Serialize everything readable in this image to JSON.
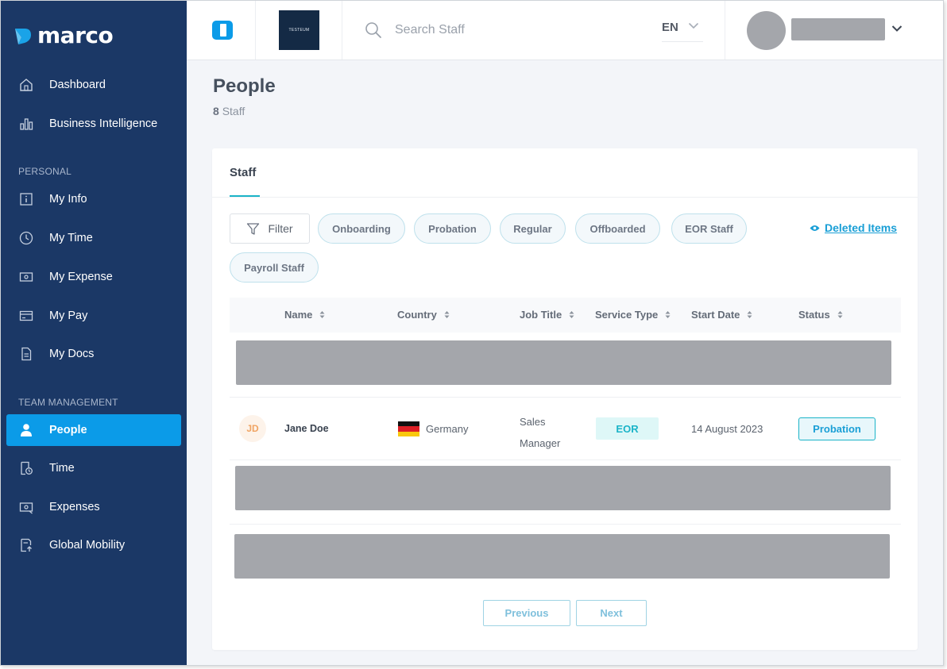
{
  "sidebar": {
    "logo_text": "marco",
    "items_top": [
      {
        "label": "Dashboard",
        "icon": "home-icon"
      },
      {
        "label": "Business Intelligence",
        "icon": "bar-chart-icon"
      }
    ],
    "section_personal": "PERSONAL",
    "items_personal": [
      {
        "label": "My Info",
        "icon": "info-icon"
      },
      {
        "label": "My Time",
        "icon": "clock-icon"
      },
      {
        "label": "My Expense",
        "icon": "expense-icon"
      },
      {
        "label": "My Pay",
        "icon": "card-icon"
      },
      {
        "label": "My Docs",
        "icon": "document-icon"
      }
    ],
    "section_team": "TEAM MANAGEMENT",
    "items_team": [
      {
        "label": "People",
        "icon": "person-icon",
        "active": true
      },
      {
        "label": "Time",
        "icon": "time-sheet-icon"
      },
      {
        "label": "Expenses",
        "icon": "expenses-icon"
      },
      {
        "label": "Global Mobility",
        "icon": "mobility-icon"
      }
    ]
  },
  "header": {
    "company_logo_text": "TESTEUM",
    "search_placeholder": "Search Staff",
    "language": "EN"
  },
  "page": {
    "title": "People",
    "staff_count": "8",
    "staff_label": "Staff"
  },
  "card": {
    "tab_label": "Staff",
    "filter_label": "Filter",
    "chips": [
      "Onboarding",
      "Probation",
      "Regular",
      "Offboarded",
      "EOR Staff",
      "Payroll Staff"
    ],
    "deleted_items_label": "Deleted Items"
  },
  "table": {
    "columns": [
      "Name",
      "Country",
      "Job Title",
      "Service Type",
      "Start Date",
      "Status"
    ],
    "rows": [
      {
        "initials": "JD",
        "name": "Jane Doe",
        "country": "Germany",
        "job_title": "Sales Manager",
        "service_type": "EOR",
        "start_date": "14 August 2023",
        "status": "Probation"
      }
    ]
  },
  "pagination": {
    "previous_label": "Previous",
    "next_label": "Next"
  },
  "colors": {
    "sidebar_bg": "#1b3866",
    "accent": "#0b9be8",
    "teal": "#1bb4c8",
    "link": "#1a9fd6",
    "mask": "#a4a6ab"
  }
}
